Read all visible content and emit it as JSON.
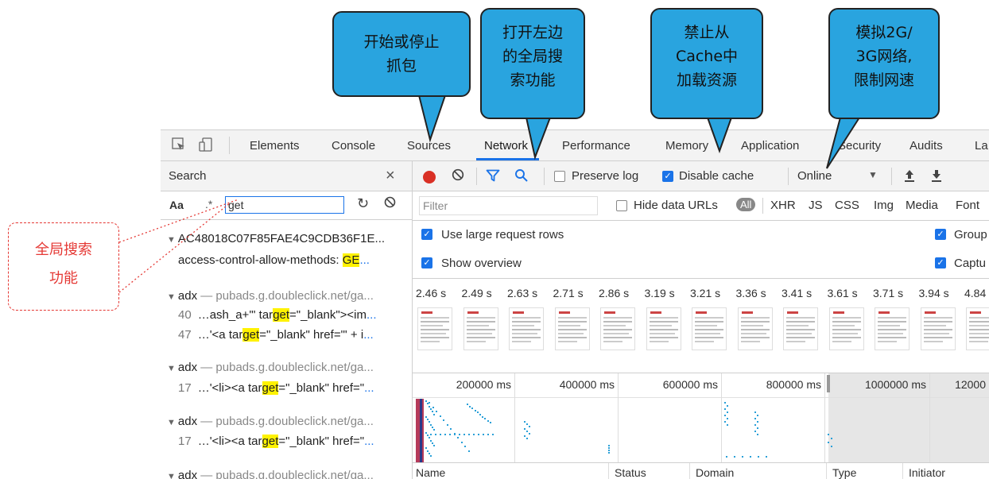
{
  "callouts": {
    "record": "开始或停止\n抓包",
    "search": "打开左边\n的全局搜\n索功能",
    "cache": "禁止从\nCache中\n加载资源",
    "network": "模拟2G/\n3G网络,\n限制网速",
    "global_search": "全局搜索\n功能"
  },
  "tabs": [
    "Elements",
    "Console",
    "Sources",
    "Network",
    "Performance",
    "Memory",
    "Application",
    "Security",
    "Audits",
    "La"
  ],
  "active_tab": "Network",
  "search_pane": {
    "title": "Search",
    "case_label": "Aa",
    "regex_label": ".*",
    "query": "get",
    "results": [
      {
        "file": "AC48018C07F85FAE4C9CDB36F1E...",
        "url": ""
      },
      {
        "file": "adx",
        "url": "— pubads.g.doubleclick.net/ga..."
      },
      {
        "file": "adx",
        "url": "— pubads.g.doubleclick.net/ga..."
      },
      {
        "file": "adx",
        "url": "— pubads.g.doubleclick.net/ga..."
      },
      {
        "file": "adx",
        "url": "— pubads.g.doubleclick.net/ga..."
      }
    ],
    "lines": [
      {
        "ln": "",
        "pre": "access-control-allow-methods:  ",
        "hit": "GE",
        "post": "",
        "more": "..."
      },
      {
        "ln": "40",
        "pre": "…ash_a+'\" tar",
        "hit": "get",
        "post": "=\"_blank\"><im",
        "more": "..."
      },
      {
        "ln": "47",
        "pre": "…'<a tar",
        "hit": "get",
        "post": "=\"_blank\" href=\"' + i",
        "more": "..."
      },
      {
        "ln": "17",
        "pre": "…'<li><a tar",
        "hit": "get",
        "post": "=\"_blank\" href=\"",
        "more": "..."
      },
      {
        "ln": "17",
        "pre": "…'<li><a tar",
        "hit": "get",
        "post": "=\"_blank\" href=\"",
        "more": "..."
      }
    ]
  },
  "toolbar": {
    "preserve_log": "Preserve log",
    "disable_cache": "Disable cache",
    "throttle": "Online"
  },
  "filterbar": {
    "placeholder": "Filter",
    "hide_urls": "Hide data URLs",
    "all": "All",
    "types": [
      "XHR",
      "JS",
      "CSS",
      "Img",
      "Media",
      "Font"
    ]
  },
  "options": {
    "large_rows": "Use large request rows",
    "group": "Group",
    "overview": "Show overview",
    "capture": "Captu"
  },
  "filmstrip_times": [
    "2.46 s",
    "2.49 s",
    "2.63 s",
    "2.71 s",
    "2.86 s",
    "3.19 s",
    "3.21 s",
    "3.36 s",
    "3.41 s",
    "3.61 s",
    "3.71 s",
    "3.94 s",
    "4.84"
  ],
  "overview_ticks": [
    "200000 ms",
    "400000 ms",
    "600000 ms",
    "800000 ms",
    "1000000 ms",
    "12000"
  ],
  "columns": [
    "Name",
    "Status",
    "Domain",
    "Type",
    "Initiator"
  ]
}
